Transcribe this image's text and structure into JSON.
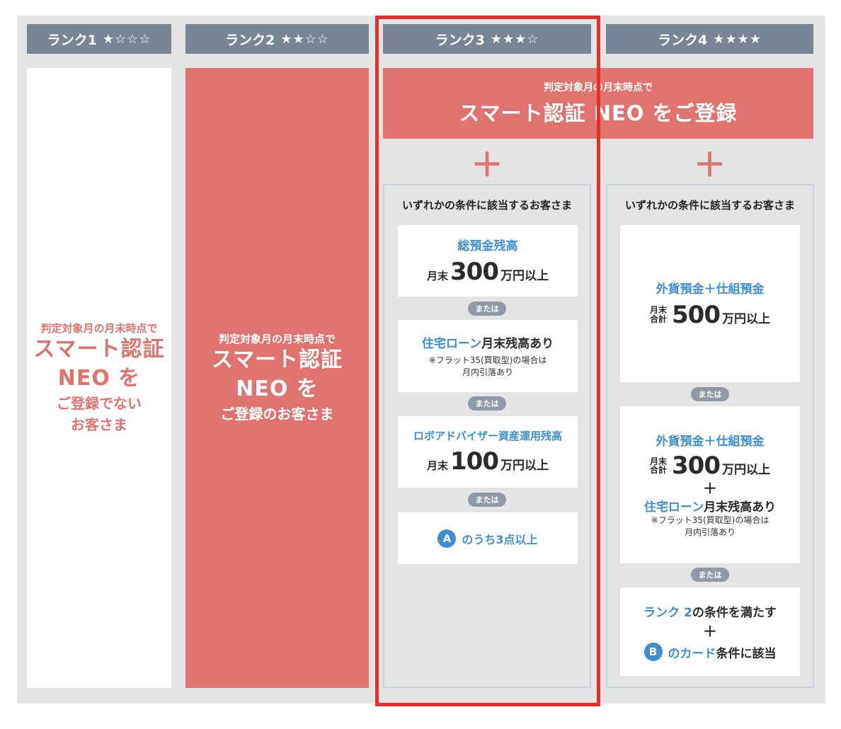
{
  "ranks": [
    {
      "label": "ランク1",
      "stars": "★☆☆☆"
    },
    {
      "label": "ランク2",
      "stars": "★★☆☆"
    },
    {
      "label": "ランク3",
      "stars": "★★★☆"
    },
    {
      "label": "ランク4",
      "stars": "★★★★"
    }
  ],
  "rank1": {
    "small": "判定対象月の月末時点で",
    "big1": "スマート認証",
    "big2": "NEO を",
    "rest1": "ご登録でない",
    "rest2": "お客さま"
  },
  "rank2": {
    "small": "判定対象月の月末時点で",
    "big1": "スマート認証",
    "big2": "NEO を",
    "rest1": "ご登録のお客さま"
  },
  "banner": {
    "small": "判定対象月の月末時点で",
    "big": "スマート認証 NEO をご登録"
  },
  "plus": "＋",
  "or": "または",
  "rank3": {
    "title": "いずれかの条件に該当するお客さま",
    "card1": {
      "label": "総預金残高",
      "prefix": "月末",
      "amount": "300",
      "unit": "万円以上"
    },
    "card2": {
      "label_blue": "住宅ローン",
      "label_rest": "月末残高あり",
      "note1": "※フラット35(買取型)の場合は",
      "note2": "月内引落あり"
    },
    "card3": {
      "label": "ロボアドバイザー資産運用残高",
      "prefix": "月末",
      "amount": "100",
      "unit": "万円以上"
    },
    "card4": {
      "badge": "A",
      "text": "のうち3点以上"
    }
  },
  "rank4": {
    "title": "いずれかの条件に該当するお客さま",
    "card1": {
      "label": "外貨預金＋仕組預金",
      "stack1": "月末",
      "stack2": "合計",
      "amount": "500",
      "unit": "万円以上"
    },
    "card2": {
      "label": "外貨預金＋仕組預金",
      "stack1": "月末",
      "stack2": "合計",
      "amount": "300",
      "unit": "万円以上",
      "plus": "＋",
      "loan_blue": "住宅ローン",
      "loan_rest": "月末残高あり",
      "note1": "※フラット35(買取型)の場合は",
      "note2": "月内引落あり"
    },
    "card3": {
      "rank_blue": "ランク 2",
      "rank_rest": "の条件を満たす",
      "plus": "＋",
      "badge": "B",
      "card_blue": "のカード",
      "card_rest": "条件に該当"
    }
  },
  "colors": {
    "header": "#778595",
    "red": "#e0736f",
    "blue": "#3f8fd0",
    "highlight": "#e4302b"
  }
}
